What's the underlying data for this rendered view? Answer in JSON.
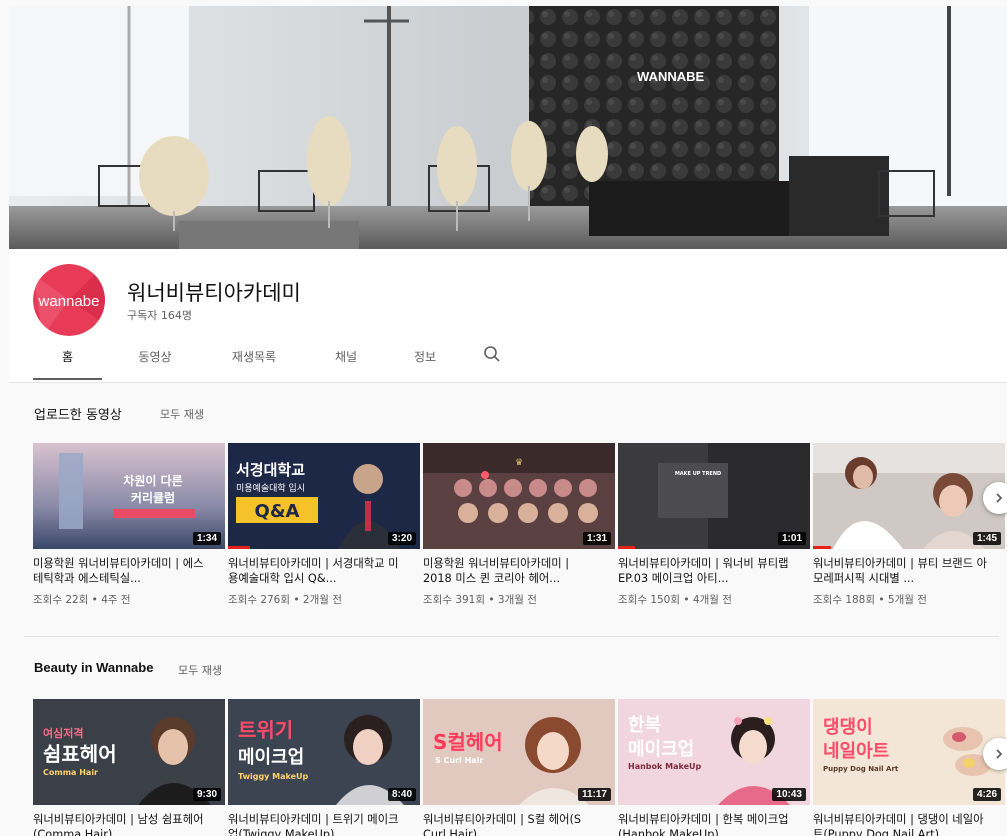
{
  "banner": {
    "brand_text": "WANNABE"
  },
  "channel": {
    "avatar_text": "wannabe",
    "name": "워너비뷰티아카데미",
    "subscribers": "구독자 164명",
    "brand_color": "#e83b57"
  },
  "tabs": [
    {
      "label": "홈",
      "active": true
    },
    {
      "label": "동영상"
    },
    {
      "label": "재생목록"
    },
    {
      "label": "채널"
    },
    {
      "label": "정보"
    }
  ],
  "sections": [
    {
      "title": "업로드한 동영상",
      "play_all": "모두 재생",
      "videos": [
        {
          "title": "미용학원 워너비뷰티아카데미 | 에스테틱학과 에스테틱실...",
          "meta": "조회수 22회 • 4주 전",
          "duration": "1:34",
          "thumb_text": "차원이 다른",
          "thumb_text2": "커리큘럼"
        },
        {
          "title": "워너비뷰티아카데미 | 서경대학교 미용예술대학 입시 Q&...",
          "meta": "조회수 276회 • 2개월 전",
          "duration": "3:20",
          "thumb_text": "서경대학교",
          "thumb_text2": "미용예술대학 입시",
          "thumb_text3": "Q&A"
        },
        {
          "title": "미용학원 워너비뷰티아카데미 | 2018 미스 퀸 코리아 헤어...",
          "meta": "조회수 391회 • 3개월 전",
          "duration": "1:31"
        },
        {
          "title": "워너비뷰티아카데미 | 워너비 뷰티랩 EP.03 메이크업 아티...",
          "meta": "조회수 150회 • 4개월 전",
          "duration": "1:01",
          "thumb_text": "MAKE UP TREND"
        },
        {
          "title": "워너비뷰티아카데미 | 뷰티 브랜드 아모레퍼시픽 시대별 ...",
          "meta": "조회수 188회 • 5개월 전",
          "duration": "1:45"
        }
      ]
    },
    {
      "title": "Beauty in Wannabe",
      "play_all": "모두 재생",
      "videos": [
        {
          "title": "워너비뷰티아카데미 | 남성 쉼표헤어(Comma Hair)",
          "duration": "9:30",
          "thumb_text": "여심저격",
          "thumb_text2": "쉼표헤어",
          "thumb_text3": "Comma Hair"
        },
        {
          "title": "워너비뷰티아카데미 | 트위기 메이크업(Twiggy MakeUp)",
          "duration": "8:40",
          "thumb_text": "트위기",
          "thumb_text2": "메이크업",
          "thumb_text3": "Twiggy MakeUp"
        },
        {
          "title": "워너비뷰티아카데미 | S컬 헤어(S Curl Hair)",
          "duration": "11:17",
          "thumb_text": "S컬헤어",
          "thumb_text3": "S Curl Hair"
        },
        {
          "title": "워너비뷰티아카데미 | 한복 메이크업(Hanbok MakeUp)",
          "duration": "10:43",
          "thumb_text": "한복",
          "thumb_text2": "메이크업",
          "thumb_text3": "Hanbok MakeUp"
        },
        {
          "title": "워너비뷰티아카데미 | 댕댕이 네일아트(Puppy Dog Nail Art)",
          "duration": "4:26",
          "thumb_text": "댕댕이",
          "thumb_text2": "네일아트",
          "thumb_text3": "Puppy Dog Nail Art"
        }
      ]
    }
  ]
}
